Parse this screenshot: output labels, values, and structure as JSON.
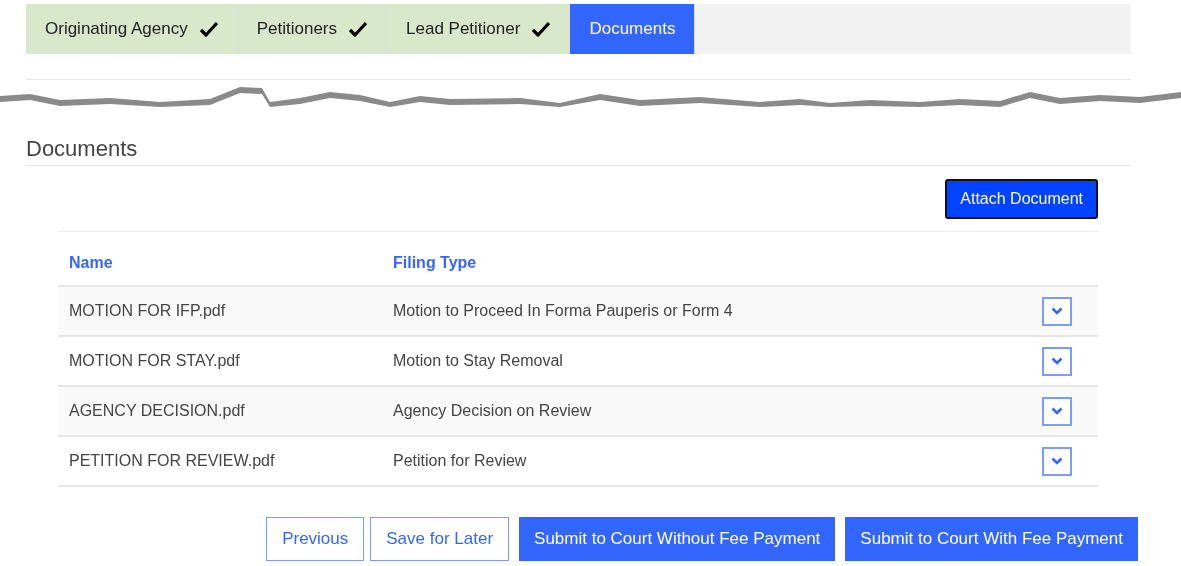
{
  "steps": [
    {
      "label": "Originating Agency",
      "completed": true,
      "selected": false
    },
    {
      "label": "Petitioners",
      "completed": true,
      "selected": false
    },
    {
      "label": "Lead Petitioner",
      "completed": true,
      "selected": false
    },
    {
      "label": "Documents",
      "completed": false,
      "selected": true
    }
  ],
  "section": {
    "title": "Documents",
    "attach_button": "Attach Document"
  },
  "table": {
    "columns": [
      "Name",
      "Filing Type"
    ],
    "rows": [
      {
        "name": "MOTION FOR IFP.pdf",
        "filing_type": "Motion to Proceed In Forma Pauperis or Form 4"
      },
      {
        "name": "MOTION FOR STAY.pdf",
        "filing_type": "Motion to Stay Removal"
      },
      {
        "name": "AGENCY DECISION.pdf",
        "filing_type": "Agency Decision on Review"
      },
      {
        "name": "PETITION FOR REVIEW.pdf",
        "filing_type": "Petition for Review"
      }
    ]
  },
  "buttons": [
    {
      "label": "Previous",
      "kind": "outline"
    },
    {
      "label": "Save for Later",
      "kind": "outline"
    },
    {
      "label": "Submit to Court Without Fee Payment",
      "kind": "primary"
    },
    {
      "label": "Submit to Court With Fee Payment",
      "kind": "primary"
    }
  ]
}
